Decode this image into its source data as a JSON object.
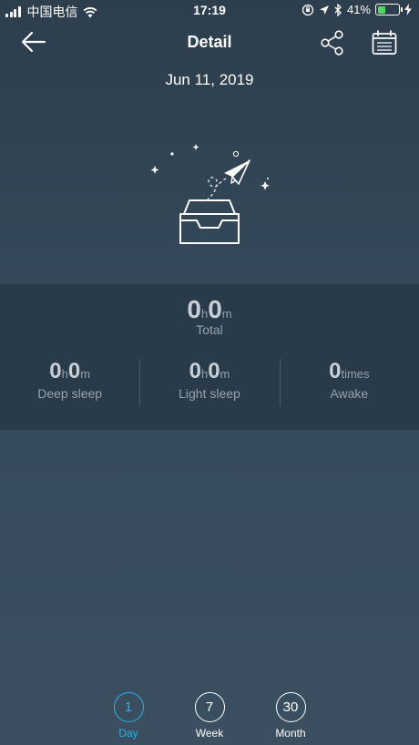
{
  "status_bar": {
    "carrier": "中国电信",
    "time": "17:19",
    "battery_percent": "41%",
    "battery_level": 0.41,
    "battery_color": "#4cd964"
  },
  "nav": {
    "title": "Detail",
    "back_icon": "arrow-left-icon",
    "share_icon": "share-icon",
    "calendar_icon": "calendar-icon"
  },
  "date": "Jun 11, 2019",
  "summary": {
    "total_hours": "0",
    "total_hours_unit": "h",
    "total_minutes": "0",
    "total_minutes_unit": "m",
    "total_label": "Total",
    "deep_sleep": {
      "hours": "0",
      "h_unit": "h",
      "minutes": "0",
      "m_unit": "m",
      "label": "Deep sleep"
    },
    "light_sleep": {
      "hours": "0",
      "h_unit": "h",
      "minutes": "0",
      "m_unit": "m",
      "label": "Light sleep"
    },
    "awake": {
      "count": "0",
      "unit": "times",
      "label": "Awake"
    }
  },
  "range_tabs": [
    {
      "number": "1",
      "label": "Day",
      "active": true
    },
    {
      "number": "7",
      "label": "Week",
      "active": false
    },
    {
      "number": "30",
      "label": "Month",
      "active": false
    }
  ],
  "colors": {
    "accent": "#23b4e8",
    "background": "#34495a",
    "panel": "#293a48"
  }
}
